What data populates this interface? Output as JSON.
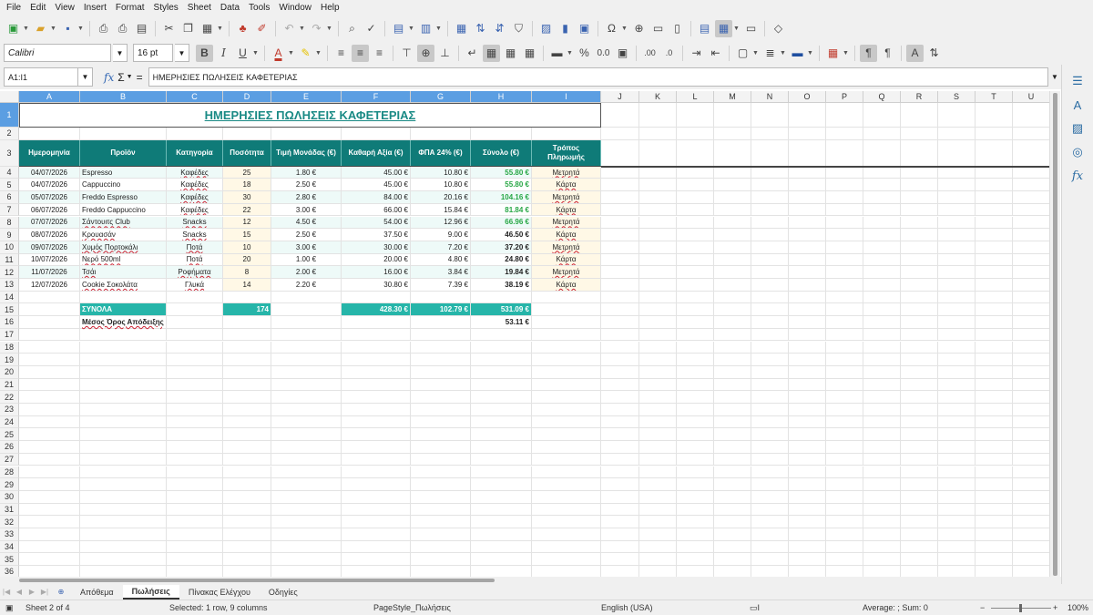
{
  "menu": [
    "File",
    "Edit",
    "View",
    "Insert",
    "Format",
    "Styles",
    "Sheet",
    "Data",
    "Tools",
    "Window",
    "Help"
  ],
  "font": {
    "name": "Calibri",
    "size": "16 pt"
  },
  "name_box": "A1:I1",
  "formula": "ΗΜΕΡΗΣΙΕΣ ΠΩΛΗΣΕΙΣ ΚΑΦΕΤΕΡΙΑΣ",
  "columns": [
    "A",
    "B",
    "C",
    "D",
    "E",
    "F",
    "G",
    "H",
    "I",
    "J",
    "K",
    "L",
    "M",
    "N",
    "O",
    "P",
    "Q",
    "R",
    "S",
    "T",
    "U"
  ],
  "rows": [
    "1",
    "2",
    "3",
    "4",
    "5",
    "6",
    "7",
    "8",
    "9",
    "10",
    "11",
    "12",
    "13",
    "14",
    "15",
    "16",
    "17",
    "18",
    "19",
    "20",
    "21",
    "22",
    "23",
    "24",
    "25",
    "26",
    "27",
    "28",
    "29",
    "30",
    "31",
    "32",
    "33",
    "34",
    "35",
    "36"
  ],
  "title": "ΗΜΕΡΗΣΙΕΣ ΠΩΛΗΣΕΙΣ ΚΑΦΕΤΕΡΙΑΣ",
  "headers": [
    "Ημερομηνία",
    "Προϊόν",
    "Κατηγορία",
    "Ποσότητα",
    "Τιμή Μονάδας (€)",
    "Καθαρή Αξία (€)",
    "ΦΠΑ 24% (€)",
    "Σύνολο (€)",
    "Τρόπος Πληρωμής"
  ],
  "data_rows": [
    [
      "04/07/2026",
      "Espresso",
      "Καφέδες",
      "25",
      "1.80 €",
      "45.00 €",
      "10.80 €",
      "55.80 €",
      "Μετρητά"
    ],
    [
      "04/07/2026",
      "Cappuccino",
      "Καφέδες",
      "18",
      "2.50 €",
      "45.00 €",
      "10.80 €",
      "55.80 €",
      "Κάρτα"
    ],
    [
      "05/07/2026",
      "Freddo Espresso",
      "Καφέδες",
      "30",
      "2.80 €",
      "84.00 €",
      "20.16 €",
      "104.16 €",
      "Μετρητά"
    ],
    [
      "06/07/2026",
      "Freddo Cappuccino",
      "Καφέδες",
      "22",
      "3.00 €",
      "66.00 €",
      "15.84 €",
      "81.84 €",
      "Κάρτα"
    ],
    [
      "07/07/2026",
      "Σάντουιτς Club",
      "Snacks",
      "12",
      "4.50 €",
      "54.00 €",
      "12.96 €",
      "66.96 €",
      "Μετρητά"
    ],
    [
      "08/07/2026",
      "Κρουασάν",
      "Snacks",
      "15",
      "2.50 €",
      "37.50 €",
      "9.00 €",
      "46.50 €",
      "Κάρτα"
    ],
    [
      "09/07/2026",
      "Χυμός Πορτοκάλι",
      "Ποτά",
      "10",
      "3.00 €",
      "30.00 €",
      "7.20 €",
      "37.20 €",
      "Μετρητά"
    ],
    [
      "10/07/2026",
      "Νερό 500ml",
      "Ποτά",
      "20",
      "1.00 €",
      "20.00 €",
      "4.80 €",
      "24.80 €",
      "Κάρτα"
    ],
    [
      "11/07/2026",
      "Τσάι",
      "Ροφήματα",
      "8",
      "2.00 €",
      "16.00 €",
      "3.84 €",
      "19.84 €",
      "Μετρητά"
    ],
    [
      "12/07/2026",
      "Cookie Σοκολάτα",
      "Γλυκά",
      "14",
      "2.20 €",
      "30.80 €",
      "7.39 €",
      "38.19 €",
      "Κάρτα"
    ]
  ],
  "totals": {
    "label": "ΣΥΝΟΛΑ",
    "qty": "174",
    "net": "428.30 €",
    "vat": "102.79 €",
    "total": "531.09 €"
  },
  "average": {
    "label": "Μέσος Όρος Απόδειξης",
    "value": "53.11 €"
  },
  "sheet_tabs": [
    "Απόθεμα",
    "Πωλήσεις",
    "Πίνακας Ελέγχου",
    "Οδηγίες"
  ],
  "active_tab": "Πωλήσεις",
  "status": {
    "sheet": "Sheet 2 of 4",
    "selection": "Selected: 1 row, 9 columns",
    "page_style": "PageStyle_Πωλήσεις",
    "language": "English (USA)",
    "sum": "Average: ; Sum: 0",
    "zoom": "100%"
  },
  "colors": {
    "header_bg": "#0f7b78",
    "total_bg": "#26b5a9",
    "title": "#1a8a85",
    "green": "#28a745",
    "selection": "#5b9ee2"
  }
}
